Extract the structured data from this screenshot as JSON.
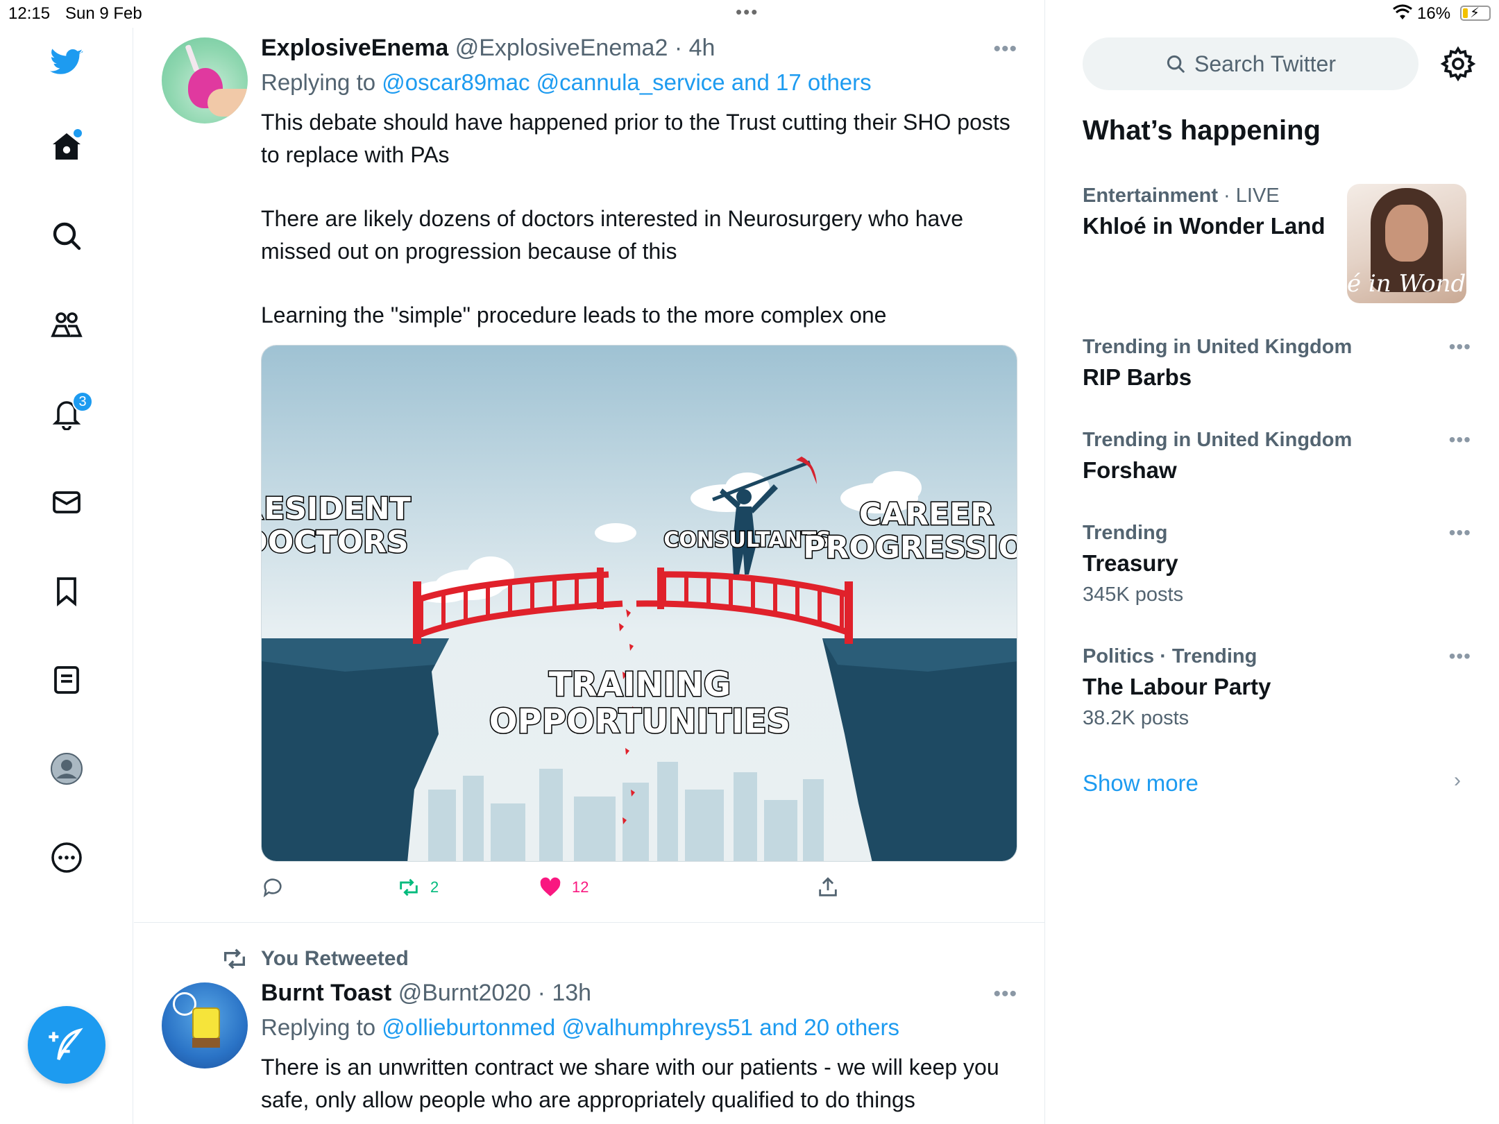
{
  "status_bar": {
    "time": "12:15",
    "date": "Sun 9 Feb",
    "battery": "16%"
  },
  "nav": {
    "items": [
      "twitter-logo",
      "home",
      "explore",
      "communities",
      "notifications",
      "messages",
      "bookmarks",
      "lists",
      "profile",
      "more"
    ],
    "notification_count": "3",
    "accent": "#1d9bf0"
  },
  "tweets": [
    {
      "name": "ExplosiveEnema",
      "handle": "@ExplosiveEnema2",
      "sep": " · ",
      "time": "4h",
      "replying_prefix": "Replying to ",
      "replying_to": "@oscar89mac @cannula_service and 17 others",
      "body": [
        "This debate should have happened prior to the Trust cutting their SHO posts to replace with PAs",
        "There are likely dozens of doctors interested in Neurosurgery who have missed out on progression because of this",
        "Learning the \"simple\" procedure leads to the more complex one"
      ],
      "meme_labels": {
        "resident": [
          "RESIDENT",
          "DOCTORS"
        ],
        "consultants": "CONSULTANTS",
        "career": [
          "CAREER",
          "PROGRESSION"
        ],
        "training": [
          "TRAINING",
          "OPPORTUNITIES"
        ]
      },
      "retweets": "2",
      "likes": "12"
    },
    {
      "retweeted_label": "You Retweeted",
      "name": "Burnt Toast",
      "handle": "@Burnt2020",
      "sep": " · ",
      "time": "13h",
      "replying_prefix": "Replying to ",
      "replying_to": "@ollieburtonmed @valhumphreys51 and 20 others",
      "body": "There is an unwritten contract we share with our patients - we will keep you safe, only allow people who are appropriately qualified to do things"
    }
  ],
  "sidebar": {
    "search_placeholder": "Search Twitter",
    "title": "What’s happening",
    "trends": [
      {
        "meta": "Entertainment",
        "meta_extra": " · LIVE",
        "title": "Khloé in Wonder Land",
        "image_caption": "é in Wonder L"
      },
      {
        "meta": "Trending in United Kingdom",
        "title": "RIP Barbs"
      },
      {
        "meta": "Trending in United Kingdom",
        "title": "Forshaw"
      },
      {
        "meta": "Trending",
        "title": "Treasury",
        "count": "345K posts"
      },
      {
        "meta": "Politics · Trending",
        "title": "The Labour Party",
        "count": "38.2K posts"
      }
    ],
    "show_more": "Show more"
  }
}
